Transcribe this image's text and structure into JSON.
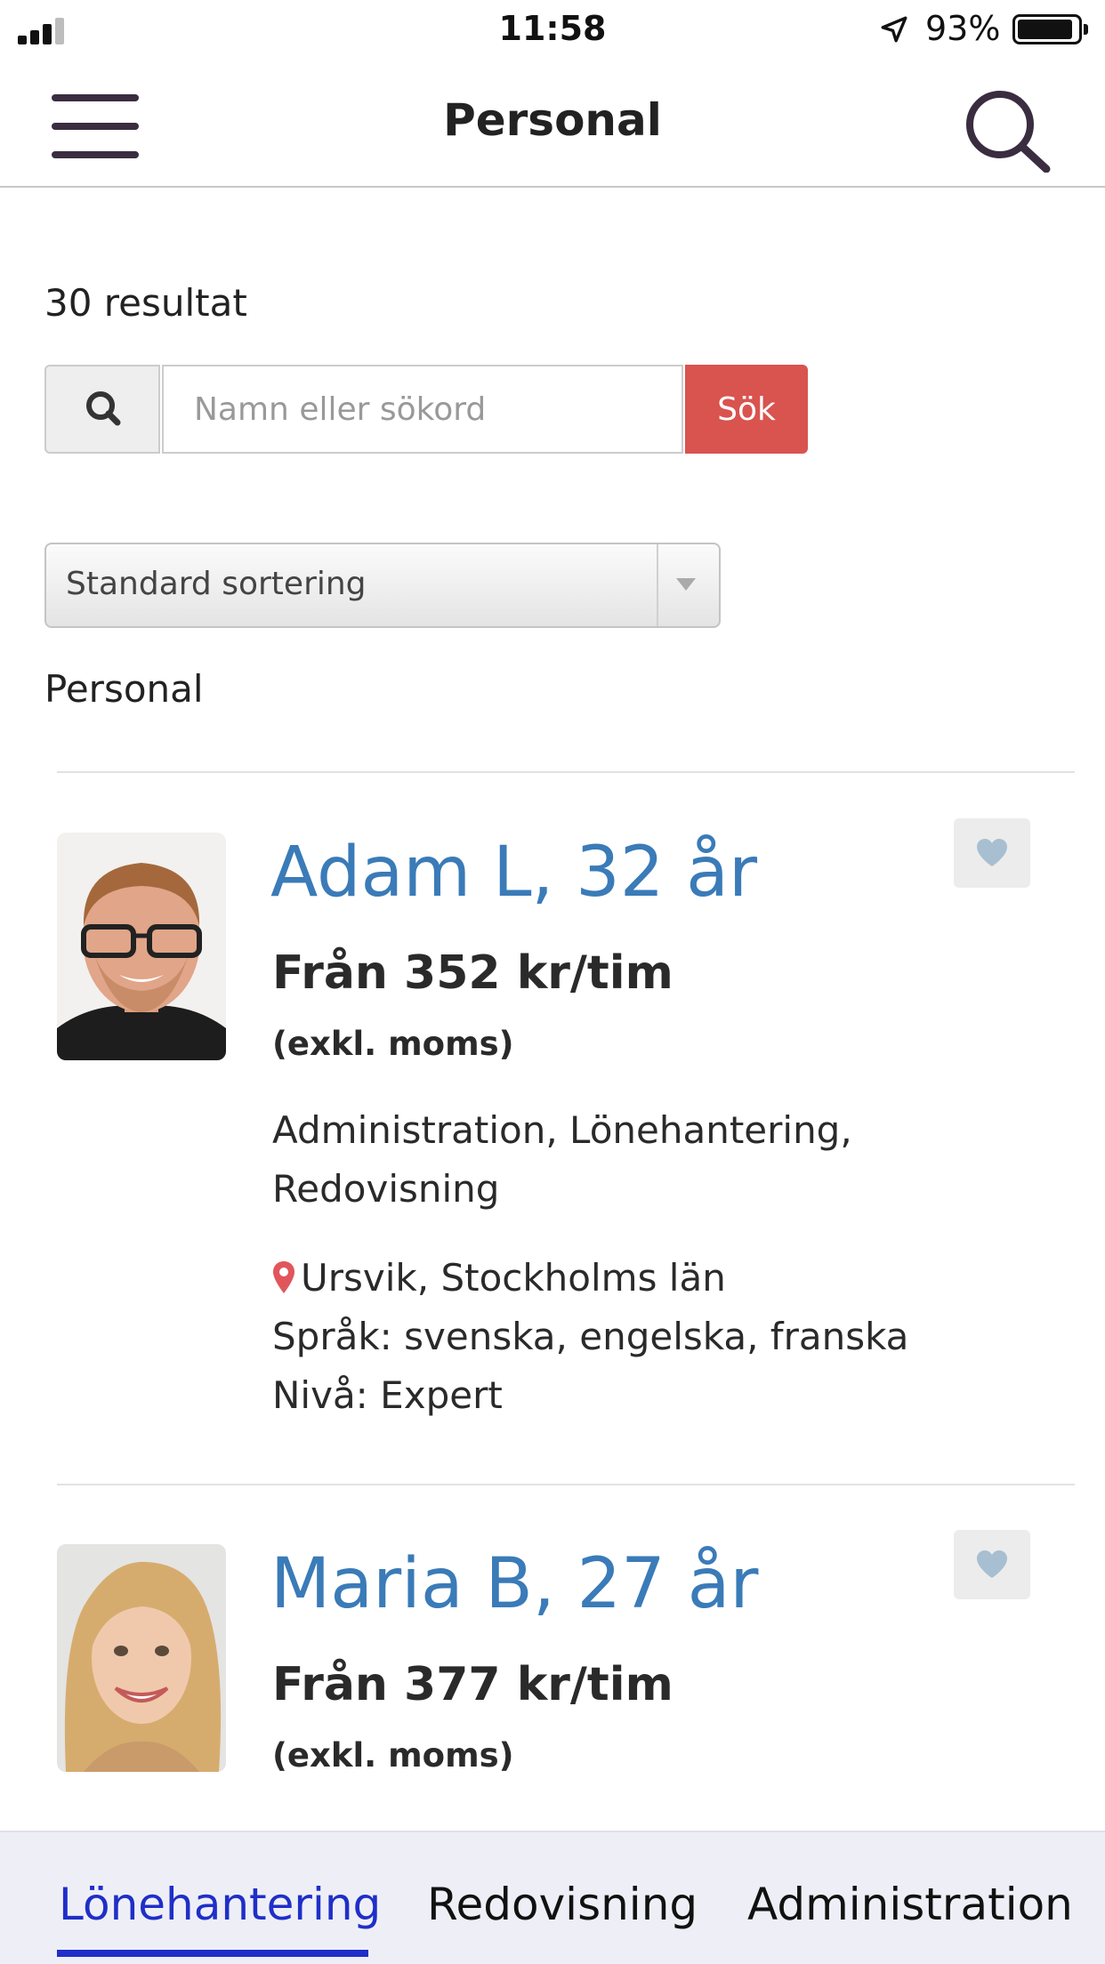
{
  "status_bar": {
    "time": "11:58",
    "battery_percent": "93%",
    "battery_level": 0.93
  },
  "nav": {
    "title": "Personal"
  },
  "results": {
    "count_text": "30 resultat"
  },
  "search": {
    "placeholder": "Namn eller sökord",
    "button_label": "Sök"
  },
  "sort": {
    "selected": "Standard sortering"
  },
  "section_label": "Personal",
  "people": [
    {
      "name": "Adam L, 32 år",
      "price": "Från 352 kr/tim",
      "vat_note": "(exkl. moms)",
      "skills": "Administration, Lönehantering, Redovisning",
      "location": "Ursvik, Stockholms län",
      "languages": "Språk: svenska, engelska, franska",
      "level": "Nivå: Expert"
    },
    {
      "name": "Maria B, 27 år",
      "price": "Från 377 kr/tim",
      "vat_note": "(exkl. moms)"
    }
  ],
  "tabs": [
    {
      "label": "Lönehantering",
      "active": true
    },
    {
      "label": "Redovisning",
      "active": false
    },
    {
      "label": "Administration",
      "active": false
    }
  ],
  "colors": {
    "accent_blue": "#3a7bb8",
    "button_red": "#d9534f",
    "tab_active": "#1f2fc8",
    "icon_dark": "#3a2d40"
  }
}
